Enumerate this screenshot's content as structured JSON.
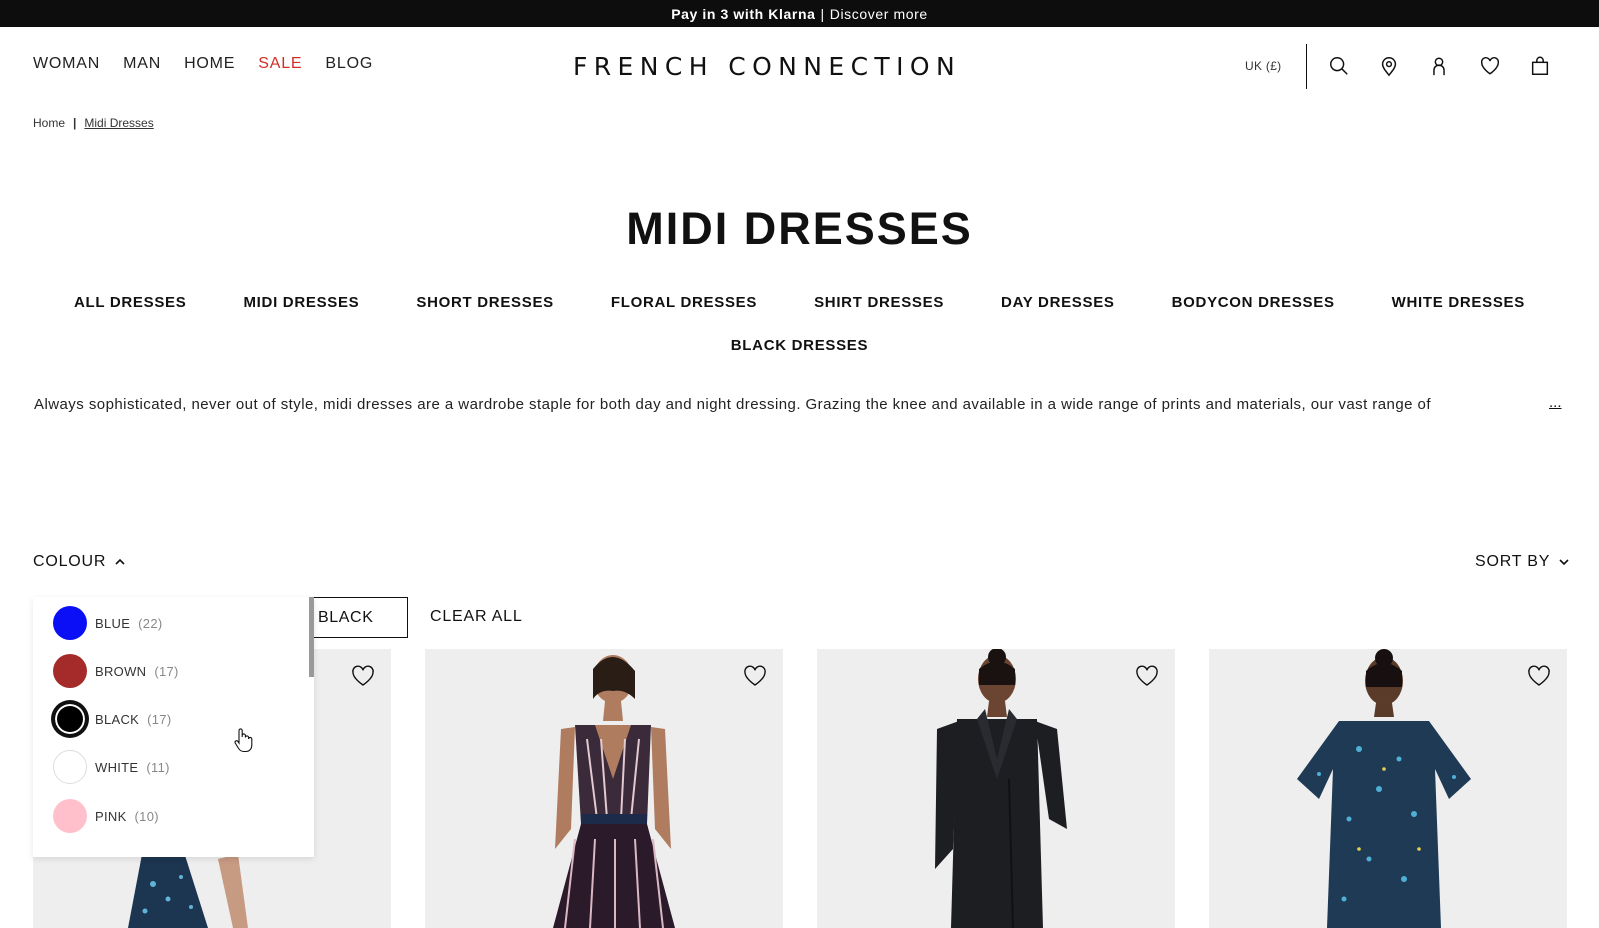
{
  "promo": {
    "strong": "Pay in 3 with Klarna",
    "separator": "|",
    "link": "Discover more"
  },
  "nav": {
    "woman": "WOMAN",
    "man": "MAN",
    "home": "HOME",
    "sale": "SALE",
    "blog": "BLOG",
    "sale_color": "#d22f27"
  },
  "brand": {
    "logo": "FRENCH CONNECTION"
  },
  "header": {
    "locale": "UK (£)",
    "icons": [
      "search-icon",
      "store-locator-icon",
      "account-icon",
      "wishlist-icon",
      "bag-icon"
    ]
  },
  "breadcrumb": {
    "home": "Home",
    "separator": "|",
    "current": "Midi Dresses"
  },
  "page": {
    "title": "MIDI DRESSES"
  },
  "categories": [
    "ALL DRESSES",
    "MIDI DRESSES",
    "SHORT DRESSES",
    "FLORAL DRESSES",
    "SHIRT DRESSES",
    "DAY DRESSES",
    "BODYCON DRESSES",
    "WHITE DRESSES",
    "BLACK DRESSES"
  ],
  "description": {
    "text": "Always sophisticated, never out of style, midi dresses are a wardrobe staple for both day and night dressing. Grazing the knee and available in a wide range of prints and materials, our vast range of",
    "more": "..."
  },
  "filters": {
    "colour_label": "COLOUR",
    "sort_label": "SORT BY",
    "active_chip": "BLACK",
    "clear_all": "CLEAR ALL",
    "colour_options": [
      {
        "name": "BLUE",
        "count": "(22)",
        "color": "#0a0ff5",
        "selected": false
      },
      {
        "name": "BROWN",
        "count": "(17)",
        "color": "#a52a2a",
        "selected": false
      },
      {
        "name": "BLACK",
        "count": "(17)",
        "color": "#000000",
        "selected": true
      },
      {
        "name": "WHITE",
        "count": "(11)",
        "color": "#ffffff",
        "selected": false
      },
      {
        "name": "PINK",
        "count": "(10)",
        "color": "#ffc0cb",
        "selected": false
      }
    ]
  },
  "products": [
    {
      "image": "printed-midi-dress"
    },
    {
      "image": "striped-knit-midi-dress"
    },
    {
      "image": "black-collared-midi-dress"
    },
    {
      "image": "printed-flutter-sleeve-midi-dress"
    }
  ]
}
